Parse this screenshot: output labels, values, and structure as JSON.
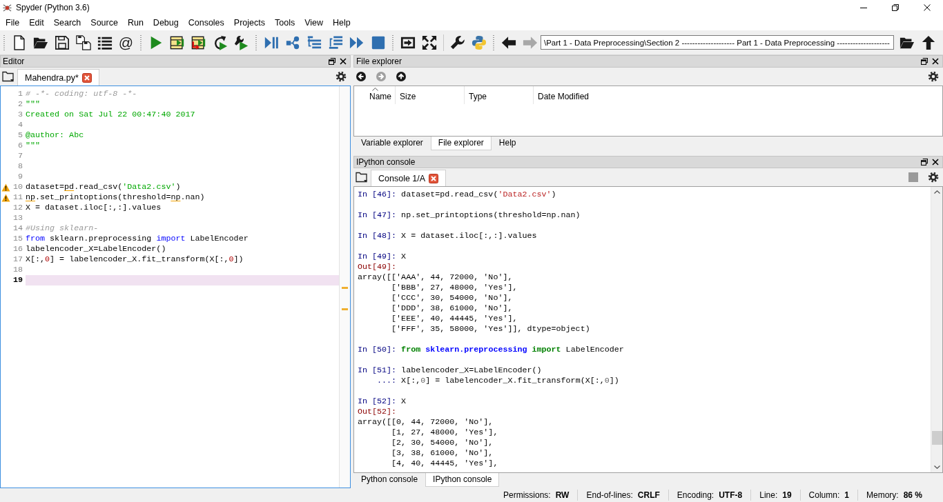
{
  "window": {
    "title": "Spyder (Python 3.6)"
  },
  "menu": [
    "File",
    "Edit",
    "Search",
    "Source",
    "Run",
    "Debug",
    "Consoles",
    "Projects",
    "Tools",
    "View",
    "Help"
  ],
  "toolbar": {
    "cell_glyph": "@",
    "working_directory": "\\Part 1 - Data Preprocessing\\Section 2 -------------------- Part 1 - Data Preprocessing --------------------"
  },
  "editor": {
    "title": "Editor",
    "tabs": [
      {
        "label": "Mahendra.py*",
        "selected": true
      }
    ],
    "lines": [
      {
        "number": "1",
        "warning": false,
        "current": false,
        "segments": [
          {
            "text": "# -*- coding: utf-8 -*-",
            "kind": "comment"
          }
        ]
      },
      {
        "number": "2",
        "warning": false,
        "current": false,
        "segments": [
          {
            "text": "\"\"\"",
            "kind": "string"
          }
        ]
      },
      {
        "number": "3",
        "warning": false,
        "current": false,
        "segments": [
          {
            "text": "Created on Sat Jul 22 00:47:40 2017",
            "kind": "string"
          }
        ]
      },
      {
        "number": "4",
        "warning": false,
        "current": false
      },
      {
        "number": "5",
        "warning": false,
        "current": false,
        "segments": [
          {
            "text": "@author: Abc",
            "kind": "string"
          }
        ]
      },
      {
        "number": "6",
        "warning": false,
        "current": false,
        "segments": [
          {
            "text": "\"\"\"",
            "kind": "string"
          }
        ]
      },
      {
        "number": "7",
        "warning": false,
        "current": false
      },
      {
        "number": "8",
        "warning": false,
        "current": false
      },
      {
        "number": "9",
        "warning": false,
        "current": false
      },
      {
        "number": "10",
        "warning": true,
        "current": false,
        "segments": [
          {
            "text": "dataset=",
            "kind": "plain"
          },
          {
            "text": "pd",
            "kind": "flagged"
          },
          {
            "text": ".read_csv(",
            "kind": "plain"
          },
          {
            "text": "'Data2.csv'",
            "kind": "string"
          },
          {
            "text": ")",
            "kind": "plain"
          }
        ]
      },
      {
        "number": "11",
        "warning": true,
        "current": false,
        "segments": [
          {
            "text": "np",
            "kind": "flagged"
          },
          {
            "text": ".set_printoptions(threshold=",
            "kind": "plain"
          },
          {
            "text": "np",
            "kind": "flagged"
          },
          {
            "text": ".nan)",
            "kind": "plain"
          }
        ]
      },
      {
        "number": "12",
        "warning": false,
        "current": false,
        "segments": [
          {
            "text": "X = dataset.iloc[:,:].values",
            "kind": "plain"
          }
        ]
      },
      {
        "number": "13",
        "warning": false,
        "current": false
      },
      {
        "number": "14",
        "warning": false,
        "current": false,
        "segments": [
          {
            "text": "#Using sklearn-",
            "kind": "comment"
          }
        ]
      },
      {
        "number": "15",
        "warning": false,
        "current": false,
        "segments": [
          {
            "text": "from",
            "kind": "keyword"
          },
          {
            "text": " sklearn.preprocessing ",
            "kind": "plain"
          },
          {
            "text": "import",
            "kind": "keyword"
          },
          {
            "text": " LabelEncoder",
            "kind": "plain"
          }
        ]
      },
      {
        "number": "16",
        "warning": false,
        "current": false,
        "segments": [
          {
            "text": "labelencoder_X=LabelEncoder()",
            "kind": "plain"
          }
        ]
      },
      {
        "number": "17",
        "warning": false,
        "current": false,
        "segments": [
          {
            "text": "X[:,",
            "kind": "plain"
          },
          {
            "text": "0",
            "kind": "number"
          },
          {
            "text": "] = labelencoder_X.fit_transform(X[:,",
            "kind": "plain"
          },
          {
            "text": "0",
            "kind": "number"
          },
          {
            "text": "])",
            "kind": "plain"
          }
        ]
      },
      {
        "number": "18",
        "warning": false,
        "current": false
      },
      {
        "number": "19",
        "warning": false,
        "current": true
      }
    ]
  },
  "file_explorer": {
    "title": "File explorer",
    "columns": [
      {
        "label": "Name",
        "sorted": true
      },
      {
        "label": "Size",
        "sorted": false
      },
      {
        "label": "Type",
        "sorted": false
      },
      {
        "label": "Date Modified",
        "sorted": false
      }
    ]
  },
  "top_dock_tabs": [
    {
      "label": "Variable explorer",
      "selected": false
    },
    {
      "label": "File explorer",
      "selected": true
    },
    {
      "label": "Help",
      "selected": false
    }
  ],
  "console": {
    "title": "IPython console",
    "tabs": [
      {
        "label": "Console 1/A",
        "selected": true
      }
    ],
    "cells": [
      {
        "lines": [
          {
            "segments": [
              {
                "text": "In [46]:",
                "kind": "in_prompt"
              },
              {
                "text": " dataset=pd.read_csv(",
                "kind": "plain"
              },
              {
                "text": "'Data2.csv'",
                "kind": "string"
              },
              {
                "text": ")",
                "kind": "plain"
              }
            ]
          }
        ]
      },
      {
        "lines": [
          {
            "segments": [
              {
                "text": "In [47]:",
                "kind": "in_prompt"
              },
              {
                "text": " np.set_printoptions(threshold=np.nan)",
                "kind": "plain"
              }
            ]
          }
        ]
      },
      {
        "lines": [
          {
            "segments": [
              {
                "text": "In [48]:",
                "kind": "in_prompt"
              },
              {
                "text": " X = dataset.iloc[:,:].values",
                "kind": "plain"
              }
            ]
          }
        ]
      },
      {
        "lines": [
          {
            "segments": [
              {
                "text": "In [49]:",
                "kind": "in_prompt"
              },
              {
                "text": " X",
                "kind": "plain"
              }
            ]
          },
          {
            "segments": [
              {
                "text": "Out[49]:",
                "kind": "out_prompt"
              }
            ]
          },
          {
            "segments": [
              {
                "text": "array([['AAA', 44, 72000, 'No'],",
                "kind": "plain"
              }
            ]
          },
          {
            "segments": [
              {
                "text": "       ['BBB', 27, 48000, 'Yes'],",
                "kind": "plain"
              }
            ]
          },
          {
            "segments": [
              {
                "text": "       ['CCC', 30, 54000, 'No'],",
                "kind": "plain"
              }
            ]
          },
          {
            "segments": [
              {
                "text": "       ['DDD', 38, 61000, 'No'],",
                "kind": "plain"
              }
            ]
          },
          {
            "segments": [
              {
                "text": "       ['EEE', 40, 44445, 'Yes'],",
                "kind": "plain"
              }
            ]
          },
          {
            "segments": [
              {
                "text": "       ['FFF', 35, 58000, 'Yes']], dtype=object)",
                "kind": "plain"
              }
            ]
          }
        ]
      },
      {
        "lines": [
          {
            "segments": [
              {
                "text": "In [50]:",
                "kind": "in_prompt"
              },
              {
                "text": " from",
                "kind": "keyword"
              },
              {
                "text": " sklearn.preprocessing",
                "kind": "module"
              },
              {
                "text": " import",
                "kind": "keyword"
              },
              {
                "text": " LabelEncoder",
                "kind": "plain"
              }
            ]
          }
        ]
      },
      {
        "lines": [
          {
            "segments": [
              {
                "text": "In [51]:",
                "kind": "in_prompt"
              },
              {
                "text": " labelencoder_X=LabelEncoder()",
                "kind": "plain"
              }
            ]
          },
          {
            "segments": [
              {
                "text": "    ...:",
                "kind": "in_prompt"
              },
              {
                "text": " X[:,",
                "kind": "plain"
              },
              {
                "text": "0",
                "kind": "number"
              },
              {
                "text": "] = labelencoder_X.fit_transform(X[:,",
                "kind": "plain"
              },
              {
                "text": "0",
                "kind": "number"
              },
              {
                "text": "])",
                "kind": "plain"
              }
            ]
          }
        ]
      },
      {
        "lines": [
          {
            "segments": [
              {
                "text": "In [52]:",
                "kind": "in_prompt"
              },
              {
                "text": " X",
                "kind": "plain"
              }
            ]
          },
          {
            "segments": [
              {
                "text": "Out[52]:",
                "kind": "out_prompt"
              }
            ]
          },
          {
            "segments": [
              {
                "text": "array([[0, 44, 72000, 'No'],",
                "kind": "plain"
              }
            ]
          },
          {
            "segments": [
              {
                "text": "       [1, 27, 48000, 'Yes'],",
                "kind": "plain"
              }
            ]
          },
          {
            "segments": [
              {
                "text": "       [2, 30, 54000, 'No'],",
                "kind": "plain"
              }
            ]
          },
          {
            "segments": [
              {
                "text": "       [3, 38, 61000, 'No'],",
                "kind": "plain"
              }
            ]
          },
          {
            "segments": [
              {
                "text": "       [4, 40, 44445, 'Yes'],",
                "kind": "plain"
              }
            ]
          }
        ]
      }
    ]
  },
  "bottom_dock_tabs": [
    {
      "label": "Python console",
      "selected": false
    },
    {
      "label": "IPython console",
      "selected": true
    }
  ],
  "status_bar": [
    {
      "label": "Permissions:",
      "value": "RW"
    },
    {
      "label": "End-of-lines:",
      "value": "CRLF"
    },
    {
      "label": "Encoding:",
      "value": "UTF-8"
    },
    {
      "label": "Line:",
      "value": "19"
    },
    {
      "label": "Column:",
      "value": "1"
    },
    {
      "label": "Memory:",
      "value": "86 %"
    }
  ]
}
